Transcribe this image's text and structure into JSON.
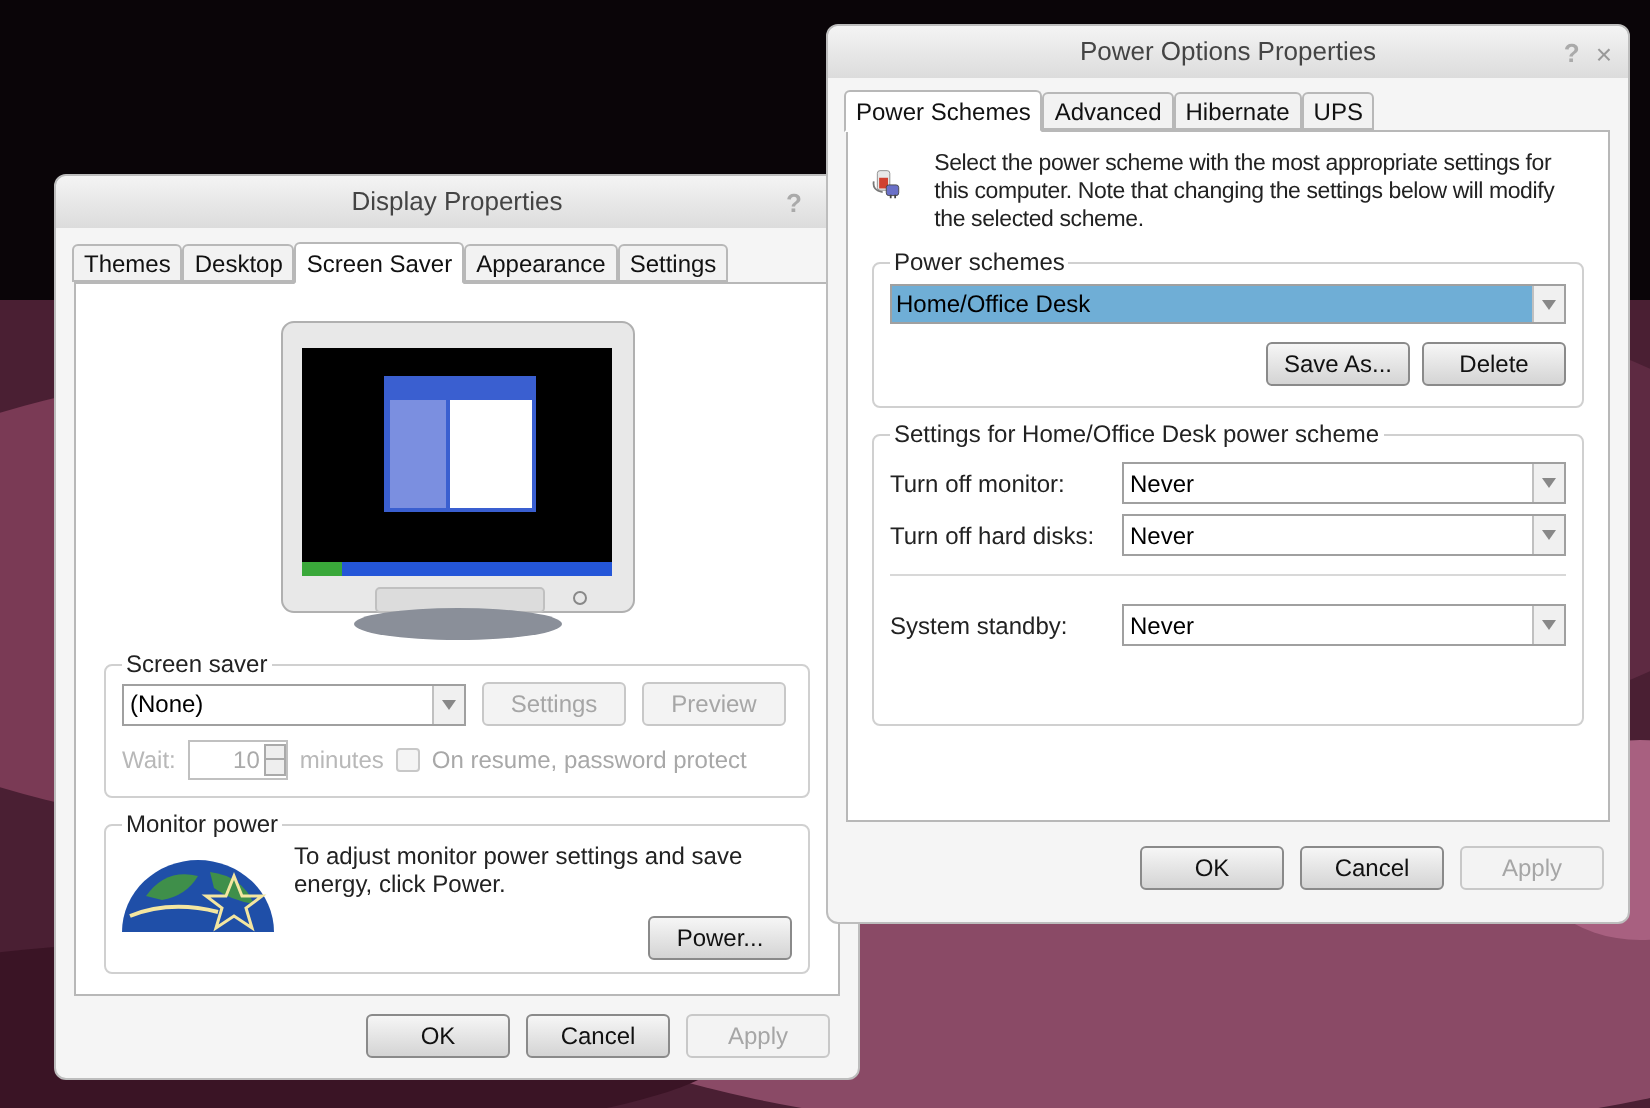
{
  "display_properties": {
    "title": "Display Properties",
    "help": "?",
    "tabs": [
      {
        "label": "Themes",
        "selected": false
      },
      {
        "label": "Desktop",
        "selected": false
      },
      {
        "label": "Screen Saver",
        "selected": true
      },
      {
        "label": "Appearance",
        "selected": false
      },
      {
        "label": "Settings",
        "selected": false
      }
    ],
    "screen_saver": {
      "legend": "Screen saver",
      "value": "(None)",
      "buttons": [
        {
          "label": "Settings",
          "disabled": true
        },
        {
          "label": "Preview",
          "disabled": true
        }
      ],
      "wait_label": "Wait:",
      "wait_value": "10",
      "minutes_label": "minutes",
      "password": {
        "label": "On resume, password protect",
        "checked": false,
        "disabled": true
      }
    },
    "monitor_power": {
      "legend": "Monitor power",
      "text": "To adjust monitor power settings and save energy, click Power.",
      "button": {
        "label": "Power...",
        "disabled": false
      }
    },
    "buttons": [
      {
        "label": "OK",
        "disabled": false
      },
      {
        "label": "Cancel",
        "disabled": false
      },
      {
        "label": "Apply",
        "disabled": true
      }
    ]
  },
  "power_options": {
    "title": "Power Options Properties",
    "help": "?",
    "close": "×",
    "tabs": [
      {
        "label": "Power Schemes",
        "selected": true
      },
      {
        "label": "Advanced",
        "selected": false
      },
      {
        "label": "Hibernate",
        "selected": false
      },
      {
        "label": "UPS",
        "selected": false
      }
    ],
    "description": "Select the power scheme with the most appropriate settings for this computer. Note that changing the settings below will modify the selected scheme.",
    "schemes": {
      "legend": "Power schemes",
      "value": "Home/Office Desk",
      "highlighted": true,
      "buttons": [
        {
          "label": "Save As...",
          "disabled": false
        },
        {
          "label": "Delete",
          "disabled": false
        }
      ]
    },
    "settings": {
      "legend": "Settings for Home/Office Desk power scheme",
      "rows": [
        {
          "label": "Turn off monitor:",
          "value": "Never"
        },
        {
          "label": "Turn off hard disks:",
          "value": "Never"
        },
        {
          "label": "System standby:",
          "value": "Never"
        }
      ]
    },
    "buttons": [
      {
        "label": "OK",
        "disabled": false
      },
      {
        "label": "Cancel",
        "disabled": false
      },
      {
        "label": "Apply",
        "disabled": true
      }
    ]
  }
}
